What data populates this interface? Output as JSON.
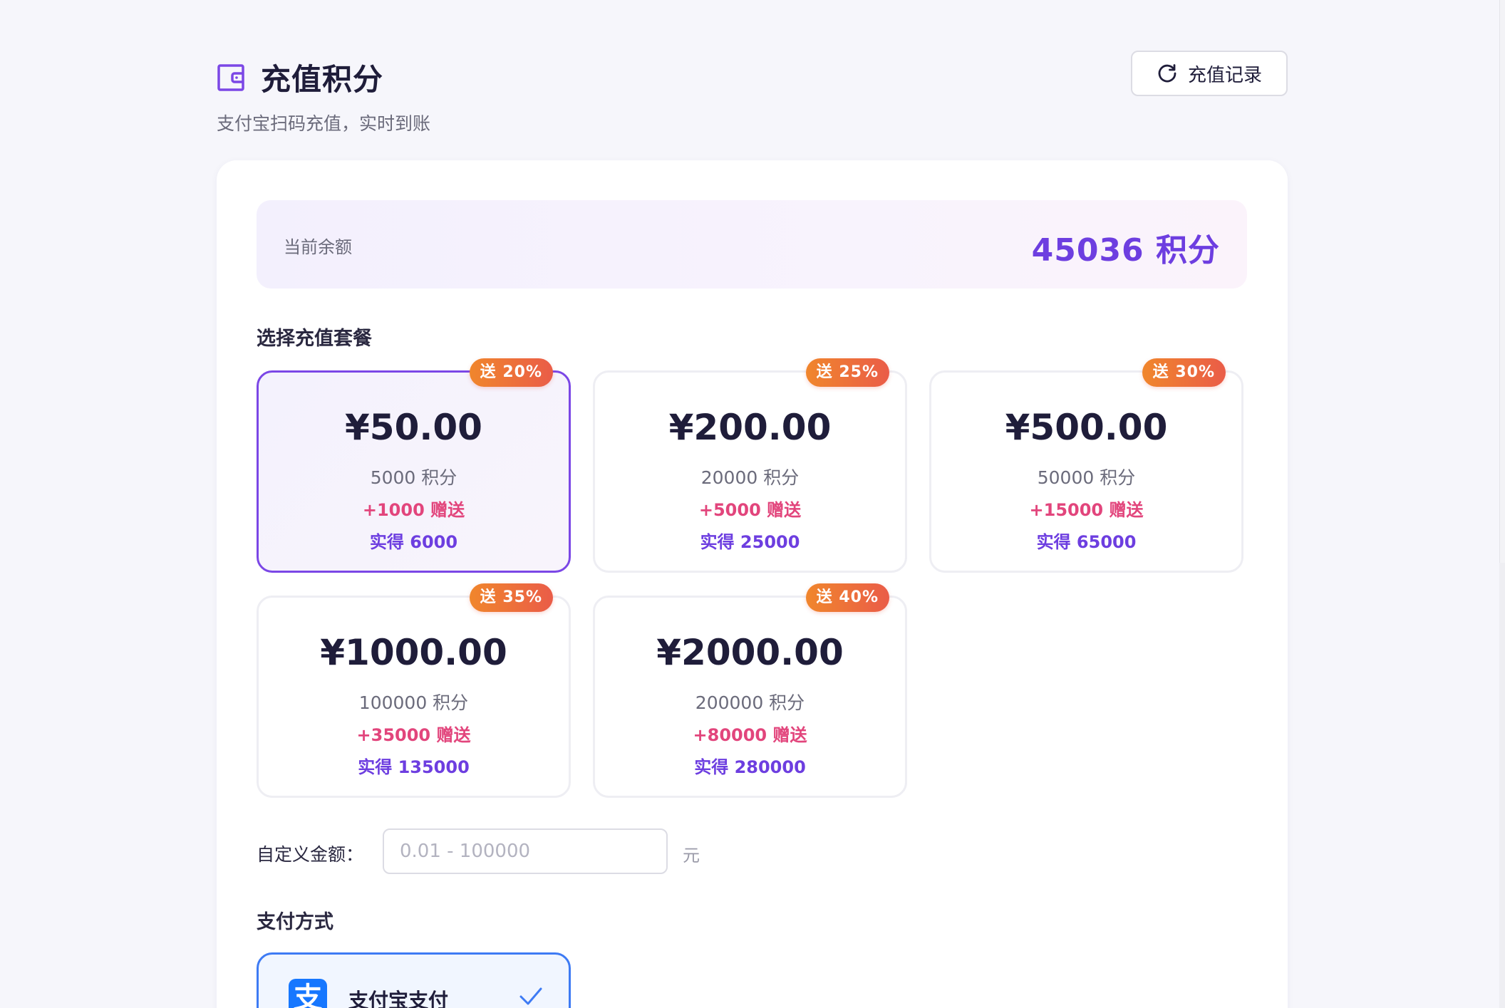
{
  "header": {
    "title": "充值积分",
    "subtitle": "支付宝扫码充值，实时到账",
    "history_button_label": "充值记录"
  },
  "balance": {
    "label": "当前余额",
    "value": "45036 积分"
  },
  "packages_section_title": "选择充值套餐",
  "packages": [
    {
      "badge": "送 20%",
      "price": "¥50.00",
      "points": "5000 积分",
      "bonus": "+1000 赠送",
      "total": "实得 6000",
      "selected": true
    },
    {
      "badge": "送 25%",
      "price": "¥200.00",
      "points": "20000 积分",
      "bonus": "+5000 赠送",
      "total": "实得 25000",
      "selected": false
    },
    {
      "badge": "送 30%",
      "price": "¥500.00",
      "points": "50000 积分",
      "bonus": "+15000 赠送",
      "total": "实得 65000",
      "selected": false
    },
    {
      "badge": "送 35%",
      "price": "¥1000.00",
      "points": "100000 积分",
      "bonus": "+35000 赠送",
      "total": "实得 135000",
      "selected": false
    },
    {
      "badge": "送 40%",
      "price": "¥2000.00",
      "points": "200000 积分",
      "bonus": "+80000 赠送",
      "total": "实得 280000",
      "selected": false
    }
  ],
  "custom_amount": {
    "label": "自定义金额：",
    "placeholder": "0.01 - 100000",
    "value": "",
    "unit": "元"
  },
  "payment_section_title": "支付方式",
  "payment_methods": [
    {
      "icon": "alipay-icon",
      "icon_glyph": "支",
      "label": "支付宝支付",
      "selected": true
    }
  ],
  "colors": {
    "accent": "#6d3ee0",
    "bonus": "#e2457c",
    "badge_start": "#f0862c",
    "badge_end": "#ea5c48",
    "alipay": "#1677ff"
  }
}
